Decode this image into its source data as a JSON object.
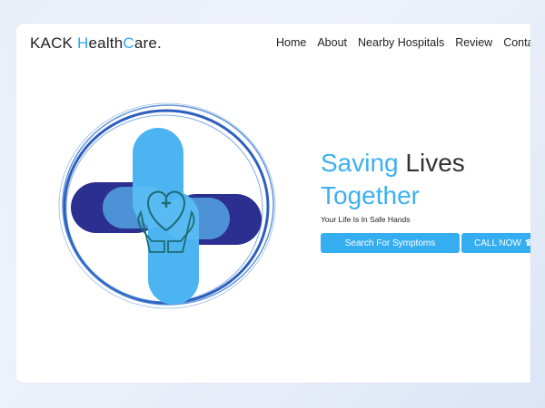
{
  "brand": {
    "part1": "KACK ",
    "h": "H",
    "mid": "ealth",
    "c": "C",
    "end": "are."
  },
  "nav": {
    "items": [
      "Home",
      "About",
      "Nearby Hospitals",
      "Review",
      "Contact"
    ]
  },
  "hero": {
    "headline_word1": "Saving",
    "headline_word2": "Lives",
    "headline_word3": "Together",
    "tagline": "Your Life Is In Safe Hands",
    "search_button": "Search For Symptoms",
    "call_button": "CALL NOW"
  },
  "icons": {
    "phone": "phone-icon",
    "logo": "medical-cross-heart-hands-icon"
  },
  "colors": {
    "accent_blue": "#3fb0ef",
    "button_blue": "#35aef1",
    "navy": "#2b2f8f",
    "cross_light": "#4db4f2",
    "ring": "#2d5fbf"
  }
}
